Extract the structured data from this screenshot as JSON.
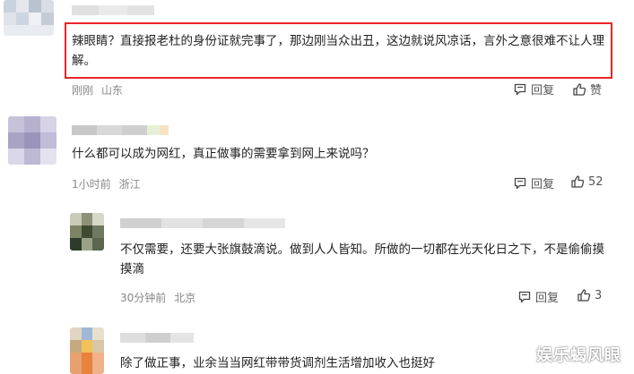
{
  "comments": [
    {
      "text": "辣眼睛？直接报老杜的身份证就完事了，那边刚当众出丑，这边就说风凉话，言外之意很难不让人理解。",
      "time": "刚刚",
      "location": "山东",
      "reply_label": "回复",
      "like_label": "赞",
      "like_count": ""
    },
    {
      "text": "什么都可以成为网红，真正做事的需要拿到网上来说吗？",
      "time": "1小时前",
      "location": "浙江",
      "reply_label": "回复",
      "like_label": "",
      "like_count": "52"
    },
    {
      "text": "不仅需要，还要大张旗鼓滴说。做到人人皆知。所做的一切都在光天化日之下，不是偷偷摸摸滴",
      "time": "30分钟前",
      "location": "北京",
      "reply_label": "回复",
      "like_label": "",
      "like_count": "3"
    },
    {
      "text": "除了做正事，业余当当网红带带货调剂生活增加收入也挺好",
      "time": "",
      "location": "",
      "reply_label": "",
      "like_label": "",
      "like_count": ""
    }
  ],
  "watermark": "娱乐蝎风眼",
  "colors": {
    "highlight_border": "#e8242a",
    "meta_text": "#888888",
    "body_text": "#222222"
  }
}
